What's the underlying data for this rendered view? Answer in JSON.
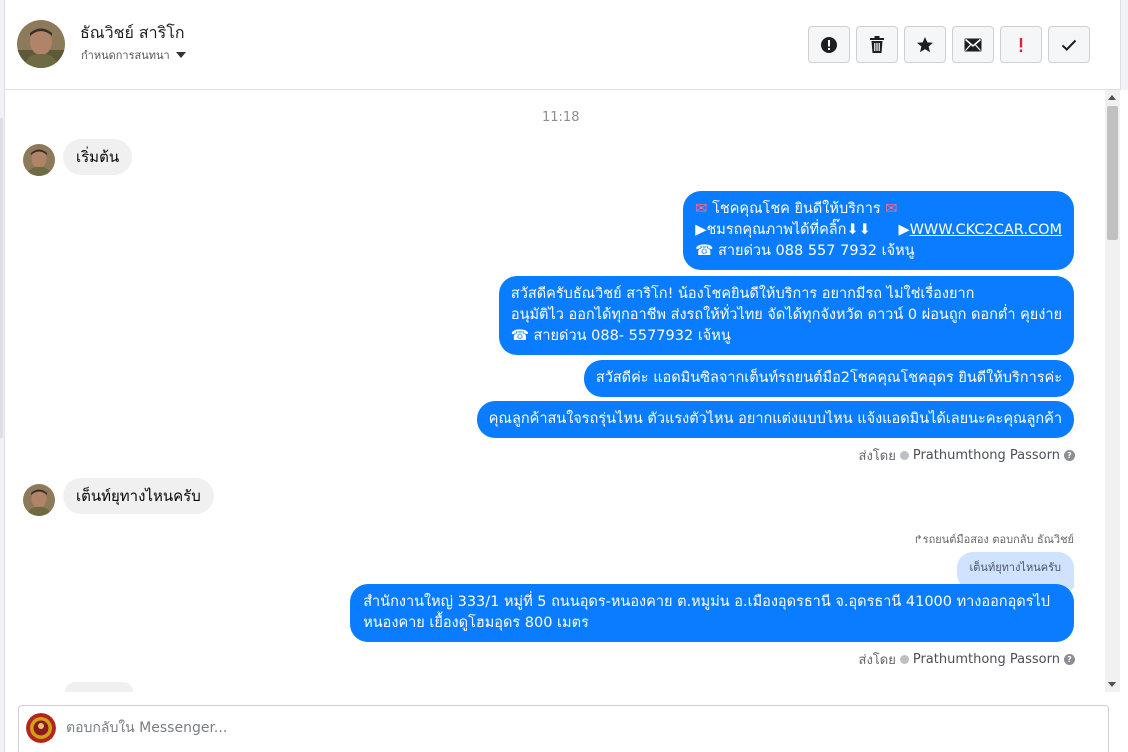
{
  "header": {
    "contact_name": "ธัณวิชย์ สาริโก",
    "assign_label": "กำหนดการสนทนา",
    "actions": [
      {
        "icon": "alert-icon",
        "name": "mark-spam-button"
      },
      {
        "icon": "trash-icon",
        "name": "delete-button"
      },
      {
        "icon": "star-icon",
        "name": "star-button"
      },
      {
        "icon": "mail-icon",
        "name": "mark-unread-button"
      },
      {
        "icon": "exclamation-icon",
        "name": "follow-up-button"
      },
      {
        "icon": "check-icon",
        "name": "mark-done-button"
      }
    ]
  },
  "conversation": {
    "timestamp": "11:18",
    "msg_in_1": "เริ่มต้น",
    "msg_out_1": {
      "line1_text": "โชคคุณโชค ยินดีให้บริการ",
      "line2_text": "ชมรถคุณภาพได้ที่คลิ๊ก",
      "line2_link": "WWW.CKC2CAR.COM",
      "line3_text": "สายด่วน 088 557 7932 เจ้หนู"
    },
    "msg_out_2": {
      "line1": "สวัสดีครับธัณวิชย์ สาริโก! น้องโชคยินดีให้บริการ อยากมีรถ ไม่ใช่เรื่องยาก",
      "line2": "อนุมัติไว ออกได้ทุกอาชีพ ส่งรถให้ทั่วไทย จัดได้ทุกจังหวัด ดาวน์ 0  ผ่อนถูก ดอกต่ำ คุยง่าย",
      "line3": "สายด่วน 088- 5577932 เจ้หนู"
    },
    "msg_out_3": "สวัสดีค่ะ แอดมินซิลจากเต็นท์รถยนต์มือ2โชคคุณโชคอุดร ยินดีให้บริการค่ะ",
    "msg_out_4": "คุณลูกค้าสนใจรถรุ่นไหน ตัวแรงตัวไหน อยากแต่งแบบไหน แจ้งแอดมินได้เลยนะคะคุณลูกค้า",
    "sent_by_label": "ส่งโดย",
    "sent_by_name": "Prathumthong Passorn",
    "msg_in_2": "เต็นท์ยุทางไหนครับ",
    "reply_label": "รถยนต์มือสอง ตอบกลับ ธัณวิชย์",
    "quoted_text": "เต็นท์ยุทางไหนครับ",
    "msg_out_5": {
      "line1": "สำนักงานใหญ่ 333/1 หมู่ที่ 5 ถนนอุดร-หนองคาย ต.หมูม่น อ.เมืองอุดรธานี จ.อุดรธานี 41000 ทางออกอุดรไป",
      "line2": "หนองคาย เยื้องดูโฮมอุดร 800 เมตร"
    },
    "sent_by_label_2": "ส่งโดย",
    "sent_by_name_2": "Prathumthong Passorn"
  },
  "composer": {
    "placeholder": "ตอบกลับใน Messenger..."
  },
  "colors": {
    "outgoing_bubble": "#0a7cff",
    "incoming_bubble": "#f0f0f0",
    "follow_up_red": "#e41e3f"
  }
}
